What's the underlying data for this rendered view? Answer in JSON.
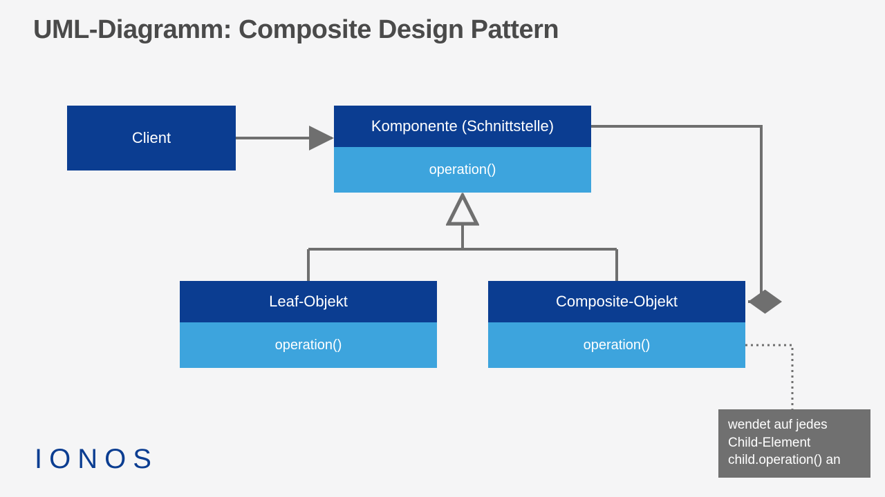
{
  "title": "UML-Diagramm: Composite Design Pattern",
  "client": {
    "label": "Client"
  },
  "component": {
    "label": "Komponente (Schnittstelle)",
    "op": "operation()"
  },
  "leaf": {
    "label": "Leaf-Objekt",
    "op": "operation()"
  },
  "composite": {
    "label": "Composite-Objekt",
    "op": "operation()"
  },
  "note": "wendet auf jedes Child-Element child.operation() an",
  "brand": "IONOS",
  "colors": {
    "dark": "#0b3d91",
    "light": "#3da4dd",
    "line": "#6f6f6f",
    "note": "#707070"
  }
}
